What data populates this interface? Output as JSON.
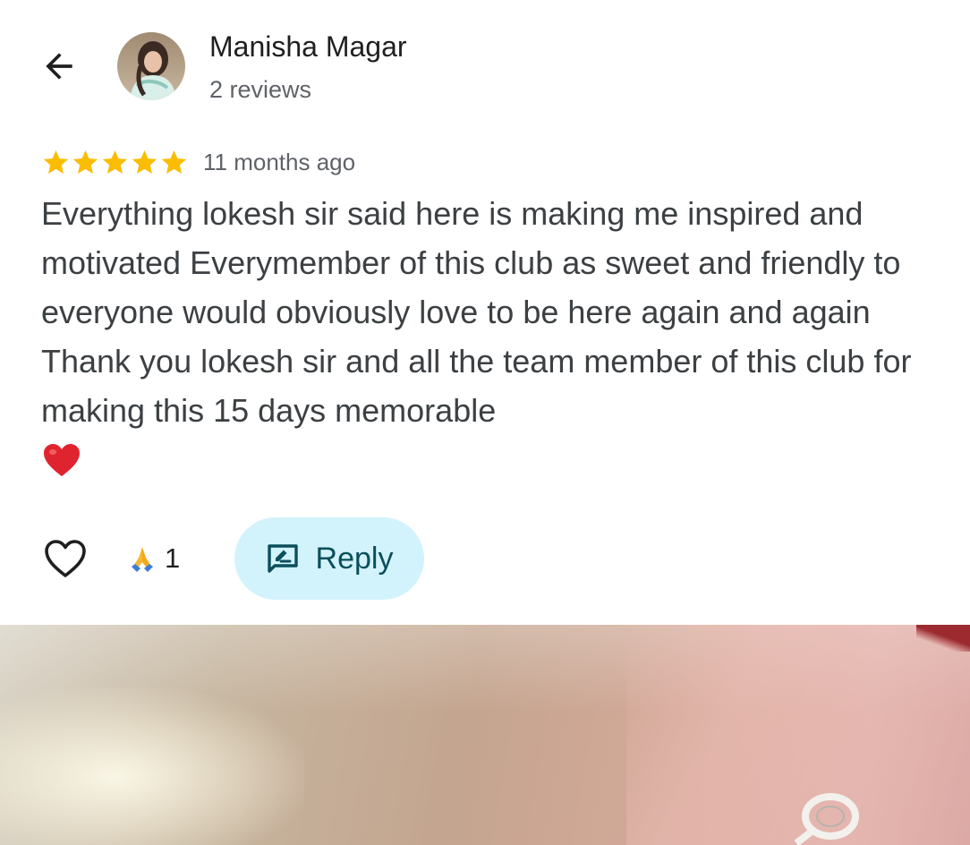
{
  "review": {
    "author_name": "Manisha Magar",
    "author_meta": "2 reviews",
    "rating": 5,
    "rating_max": 5,
    "time_ago": "11 months ago",
    "text": "Everything lokesh sir said here is making me inspired and motivated Everymember of this club as sweet and friendly to everyone would obviously love to be here again and again Thank you lokesh sir and all the team member of this club for making this 15 days memorable",
    "text_emoji": "red-heart-emoji"
  },
  "actions": {
    "like_icon": "heart-outline-icon",
    "reaction_icon": "folded-hands-emoji",
    "reaction_count": "1",
    "reply_label": "Reply",
    "reply_icon": "rate-review-icon"
  },
  "header": {
    "back_icon": "arrow-back-icon"
  },
  "colors": {
    "star": "#fbbc04",
    "reply_bg": "#d3f3fc",
    "reply_text": "#0b4f5c",
    "primary_text": "#1f1f1f",
    "secondary_text": "#5f6368",
    "body_text": "#3c4043"
  }
}
